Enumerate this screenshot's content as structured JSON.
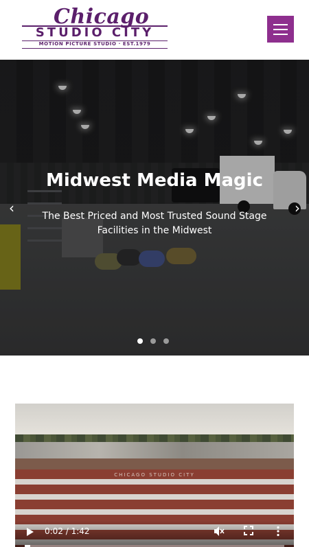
{
  "header": {
    "logo": {
      "script": "Chicago",
      "main": "STUDIO CITY",
      "sub": "MOTION PICTURE STUDIO · EST.1979"
    },
    "menu_icon": "hamburger-menu-icon",
    "colors": {
      "brand": "#5b1f6b",
      "menu_button": "#8e2f8e"
    }
  },
  "hero": {
    "title": "Midwest Media Magic",
    "subtitle": "The Best Priced and Most Trusted Sound Stage Facilities in the Midwest",
    "prev_icon": "‹",
    "next_icon": "›",
    "slides_total": 3,
    "active_slide": 1
  },
  "video": {
    "sign_text": "CHICAGO STUDIO CITY",
    "time_display": "0:02 / 1:42",
    "progress_fraction": 0.02,
    "icons": [
      "play-icon",
      "muted-volume-icon",
      "fullscreen-icon",
      "more-options-icon"
    ]
  }
}
